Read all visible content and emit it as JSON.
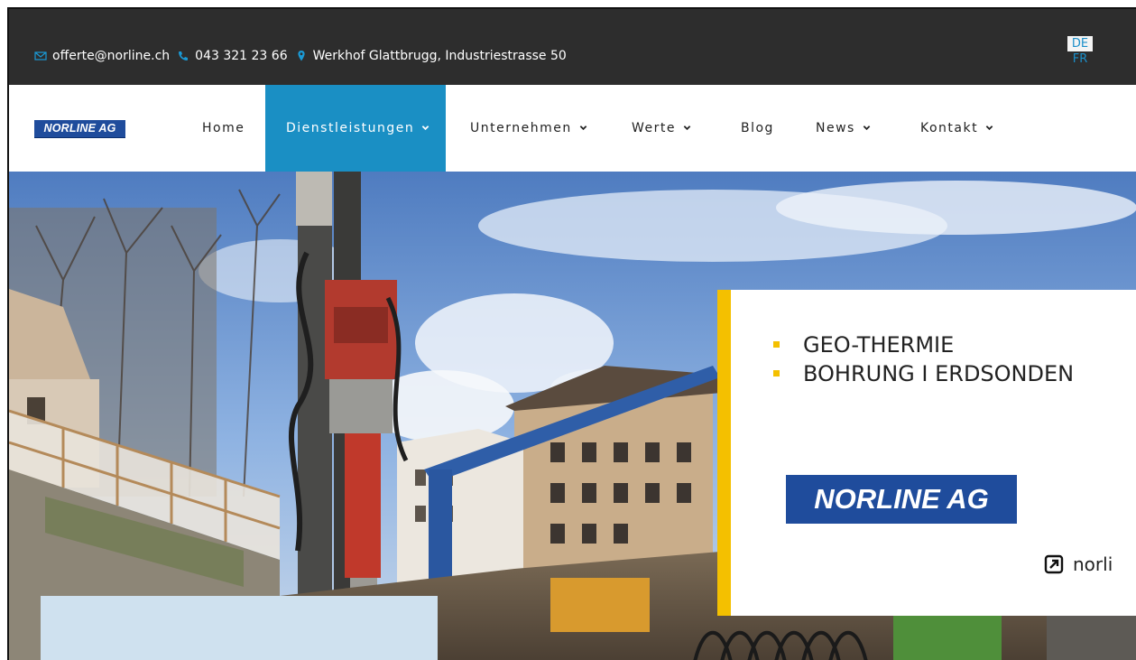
{
  "topbar": {
    "email": "offerte@norline.ch",
    "phone": "043 321 23 66",
    "address": "Werkhof Glattbrugg, Industriestrasse 50",
    "icons": [
      "envelope-icon",
      "phone-icon",
      "location-pin-icon"
    ],
    "languages": [
      "DE",
      "FR"
    ],
    "background": "#2d2d2d"
  },
  "nav": {
    "logo_text": "NORLINE AG",
    "items": [
      {
        "label": "Home",
        "dropdown": false
      },
      {
        "label": "Dienstleistungen",
        "dropdown": true,
        "active": true
      },
      {
        "label": "Unternehmen",
        "dropdown": true
      },
      {
        "label": "Werte",
        "dropdown": true
      },
      {
        "label": "Blog",
        "dropdown": false
      },
      {
        "label": "News",
        "dropdown": true
      },
      {
        "label": "Kontakt",
        "dropdown": true
      }
    ],
    "active_color": "#1a8fc4"
  },
  "hero": {
    "card": {
      "bullets": [
        "GEO-THERMIE",
        "BOHRUNG I ERDSONDEN"
      ],
      "logo_text": "NORLINE AG",
      "link_text": "norli",
      "accent_color": "#f4c000"
    }
  }
}
